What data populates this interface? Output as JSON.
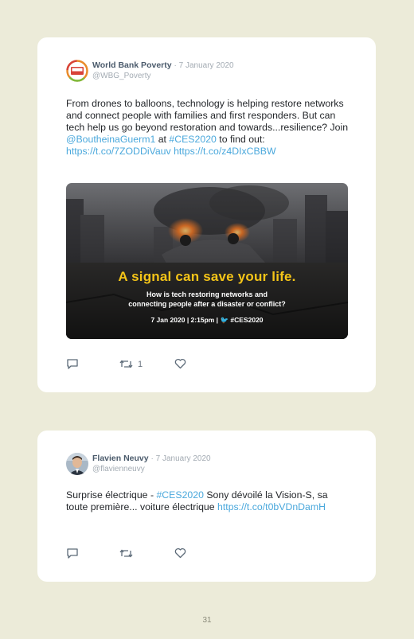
{
  "tweets": [
    {
      "author": "World Bank Poverty",
      "date": "· 7 January 2020",
      "handle": "@WBG_Poverty",
      "avatar_text": "END POVERTY",
      "text_parts": [
        "From drones to balloons, technology is helping restore networks and connect people with families and first responders. But can tech help us go beyond restoration and towards...resilience? Join ",
        "@BoutheinaGuerm1",
        " at ",
        "#CES2020",
        " to find out: ",
        "https://t.co/7ZODDiVauv",
        " ",
        "https://t.co/z4DIxCBBW"
      ],
      "media": {
        "title": "A signal can save your life.",
        "subtitle_line1": "How is tech restoring networks and",
        "subtitle_line2": "connecting people after a disaster or conflict?",
        "footer_date": "7 Jan 2020 | 2:15pm |",
        "footer_hashtag": "#CES2020"
      },
      "retweet_count": "1",
      "icons": [
        "reply-icon",
        "retweet-icon",
        "like-icon"
      ]
    },
    {
      "author": "Flavien Neuvy",
      "date": "· 7 January 2020",
      "handle": "@flavienneuvy",
      "text_parts": [
        "Surprise électrique - ",
        "#CES2020",
        " Sony dévoilé la Vision-S, sa toute première... voiture électrique ",
        "https://t.co/t0bVDnDamH"
      ],
      "icons": [
        "reply-icon",
        "retweet-icon",
        "like-icon"
      ]
    }
  ],
  "colors": {
    "background": "#ecebd9",
    "card": "#ffffff",
    "link": "#4aa8dc",
    "banner_title": "#f5c518"
  },
  "page_number": "31"
}
